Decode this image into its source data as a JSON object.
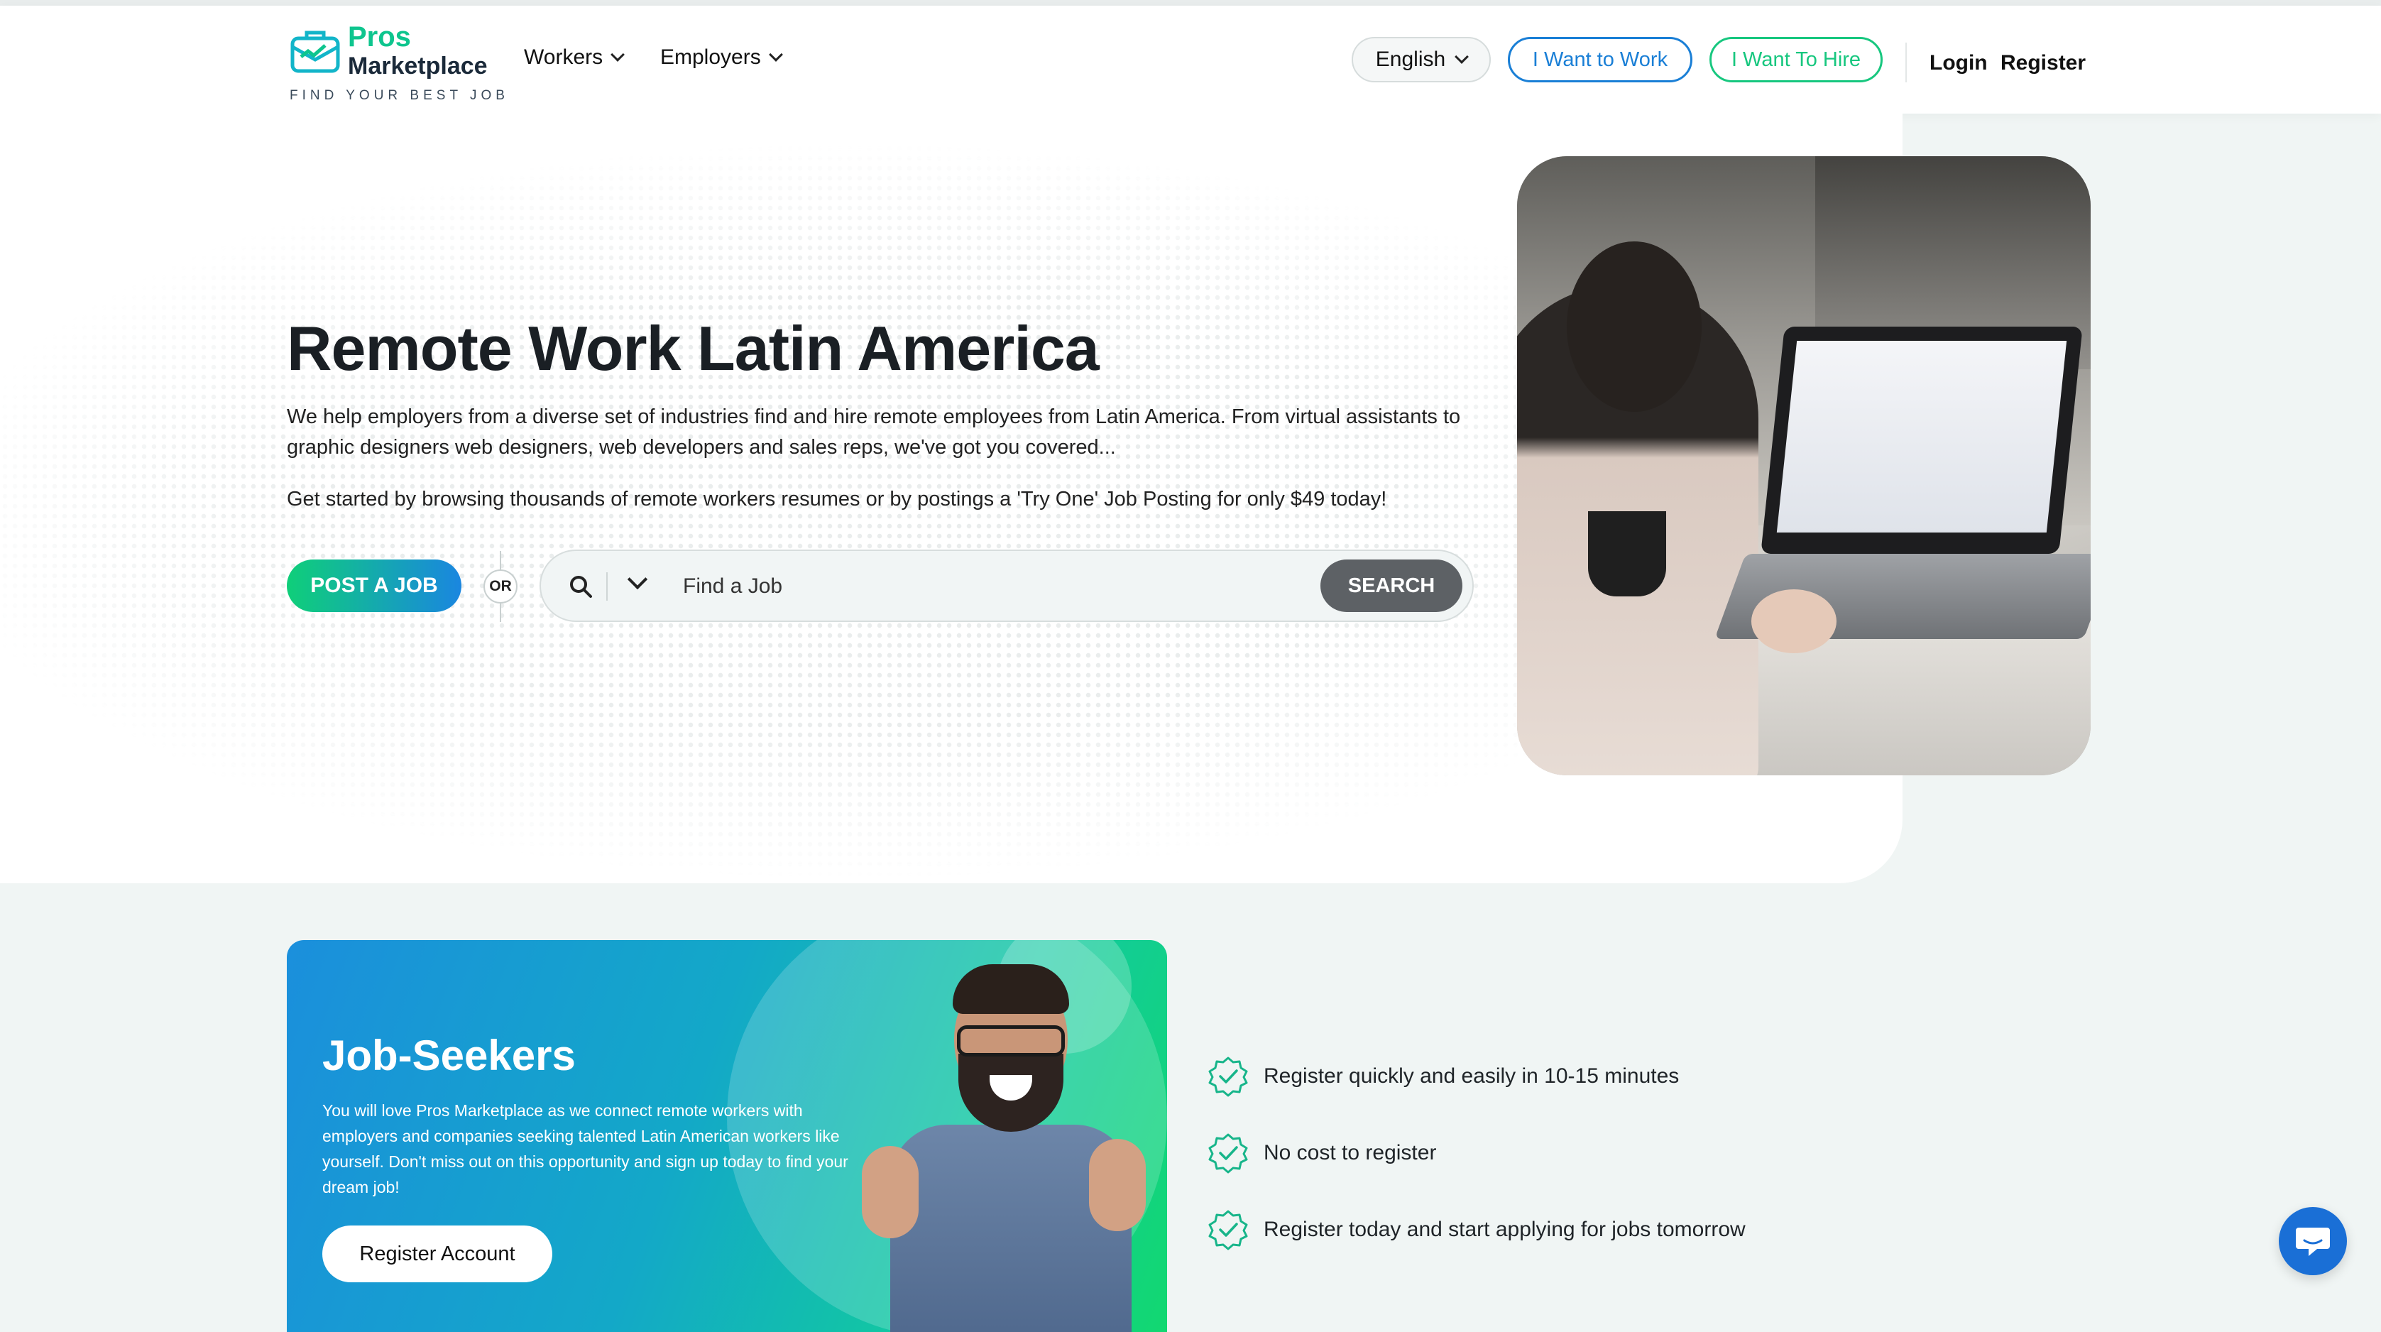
{
  "brand": {
    "name_top": "Pros",
    "name_bottom": "Marketplace",
    "tagline": "FIND YOUR BEST JOB",
    "brand_color": "#0ec58e"
  },
  "nav": {
    "workers_label": "Workers",
    "employers_label": "Employers",
    "language": "English",
    "want_work_label": "I Want to Work",
    "want_hire_label": "I Want To Hire",
    "login_label": "Login",
    "register_label": "Register",
    "want_work_color": "#1a7fd6",
    "want_hire_color": "#17c77f"
  },
  "hero": {
    "title": "Remote Work Latin America",
    "paragraph1": "We help employers from a diverse set of industries find and hire remote employees from Latin America. From virtual assistants to graphic designers web designers, web developers and sales reps, we've got you covered...",
    "paragraph2": "Get started by browsing thousands of remote workers resumes or by postings a 'Try One' Job Posting for only $49 today!",
    "post_job_label": "POST A JOB",
    "or_label": "OR",
    "search_placeholder": "Find a Job",
    "search_button_label": "SEARCH"
  },
  "job_seekers": {
    "title": "Job-Seekers",
    "text": "You will love Pros Marketplace as we connect remote workers with employers and companies seeking talented Latin American workers like yourself. Don't miss out on this opportunity and sign up today to find your dream job!",
    "button_label": "Register Account"
  },
  "benefits": [
    {
      "text": "Register quickly and easily in 10-15 minutes",
      "icon": "check-badge-icon"
    },
    {
      "text": "No cost to register",
      "icon": "check-badge-icon"
    },
    {
      "text": "Register today and start applying for jobs tomorrow",
      "icon": "check-badge-icon"
    }
  ],
  "chat": {
    "icon": "chat-bubble-icon"
  }
}
